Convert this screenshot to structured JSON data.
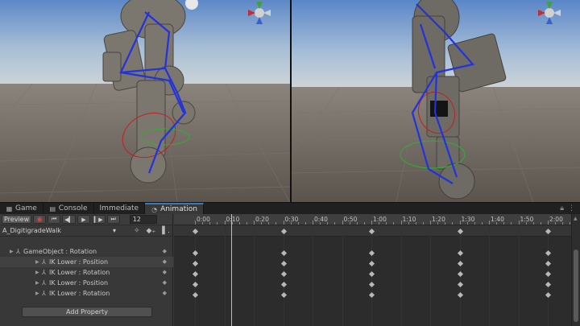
{
  "tabs": [
    {
      "label": "Game",
      "icon": "game-icon"
    },
    {
      "label": "Console",
      "icon": "console-icon"
    },
    {
      "label": "Immediate",
      "icon": ""
    },
    {
      "label": "Animation",
      "icon": "animation-icon"
    }
  ],
  "toolbar": {
    "preview_label": "Preview",
    "frame_value": "12"
  },
  "clip": {
    "name": "A_DigitigradeWalk"
  },
  "properties": [
    {
      "label": "GameObject : Rotation",
      "level": "parent"
    },
    {
      "label": "IK Lower : Position",
      "level": "child"
    },
    {
      "label": "IK Lower : Rotation",
      "level": "child"
    },
    {
      "label": "IK Lower : Position",
      "level": "child"
    },
    {
      "label": "IK Lower : Rotation",
      "level": "child"
    }
  ],
  "add_property_label": "Add Property",
  "ruler_labels": [
    "0:00",
    "0:10",
    "0:20",
    "0:30",
    "0:40",
    "0:50",
    "1:00",
    "1:10",
    "1:20",
    "1:30",
    "1:40",
    "1:50",
    "2:00"
  ],
  "keyframe_times": [
    "0:00",
    "0:30",
    "1:00",
    "1:30",
    "2:00"
  ],
  "colors": {
    "accent": "#3a79bb",
    "record": "#d04a3a",
    "bone": "#2233dd",
    "ik_ring_red": "#c02020",
    "ik_ring_green": "#30b030"
  }
}
